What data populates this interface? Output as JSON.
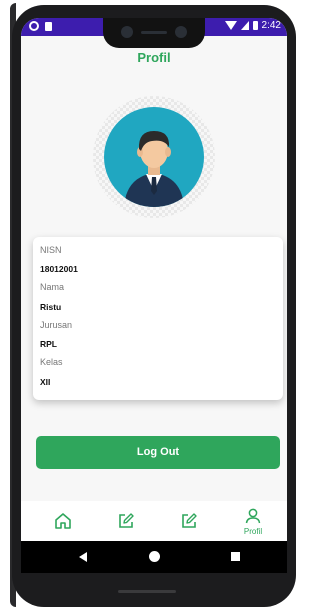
{
  "status_bar": {
    "time": "2:42"
  },
  "header": {
    "title": "Profil"
  },
  "profile": {
    "fields": [
      {
        "label": "NISN",
        "value": "18012001"
      },
      {
        "label": "Nama",
        "value": "Ristu"
      },
      {
        "label": "Jurusan",
        "value": "RPL"
      },
      {
        "label": "Kelas",
        "value": "XII"
      }
    ]
  },
  "actions": {
    "logout_label": "Log Out"
  },
  "bottom_nav": {
    "items": [
      {
        "icon": "home-icon",
        "label": ""
      },
      {
        "icon": "edit-icon",
        "label": ""
      },
      {
        "icon": "edit-icon",
        "label": ""
      },
      {
        "icon": "user-icon",
        "label": "Profil"
      }
    ]
  },
  "colors": {
    "accent": "#2fa65c",
    "status_bar": "#3d1dae",
    "avatar_bg": "#20a7c1"
  }
}
